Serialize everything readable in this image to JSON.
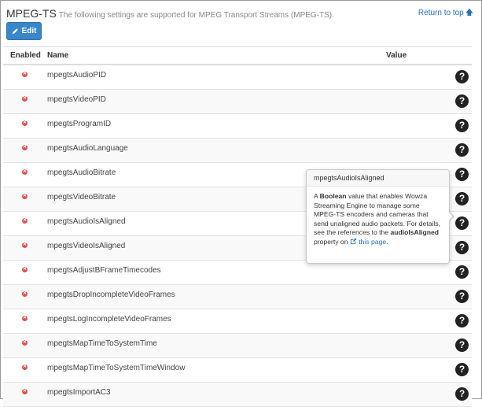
{
  "header": {
    "title": "MPEG-TS",
    "subtitle": "The following settings are supported for MPEG Transport Streams (MPEG-TS).",
    "return_to_top": "Return to top",
    "return_arrow": "🡅"
  },
  "toolbar": {
    "edit_label": "Edit",
    "edit_icon": "pencil-icon"
  },
  "table": {
    "columns": {
      "enabled": "Enabled",
      "name": "Name",
      "value": "Value"
    },
    "rows": [
      {
        "name": "mpegtsAudioPID",
        "enabled": false
      },
      {
        "name": "mpegtsVideoPID",
        "enabled": false
      },
      {
        "name": "mpegtsProgramID",
        "enabled": false
      },
      {
        "name": "mpegtsAudioLanguage",
        "enabled": false
      },
      {
        "name": "mpegtsAudioBitrate",
        "enabled": false
      },
      {
        "name": "mpegtsVideoBitrate",
        "enabled": false
      },
      {
        "name": "mpegtsAudioIsAligned",
        "enabled": false
      },
      {
        "name": "mpegtsVideoIsAligned",
        "enabled": false
      },
      {
        "name": "mpegtsAdjustBFrameTimecodes",
        "enabled": false
      },
      {
        "name": "mpegtsDropIncompleteVideoFrames",
        "enabled": false
      },
      {
        "name": "mpegtsLogIncompleteVideoFrames",
        "enabled": false
      },
      {
        "name": "mpegtsMapTimeToSystemTime",
        "enabled": false
      },
      {
        "name": "mpegtsMapTimeToSystemTimeWindow",
        "enabled": false
      },
      {
        "name": "mpegtsImportAC3",
        "enabled": false
      }
    ],
    "disabled_glyph": "✕",
    "help_glyph": "?"
  },
  "popover": {
    "title": "mpegtsAudioIsAligned",
    "body_pre": "A ",
    "body_bold1": "Boolean",
    "body_mid": " value that enables Wowza Streaming Engine to manage some MPEG-TS encoders and cameras that send unaligned audio packets. For details, see the references to the ",
    "body_bold2": "audioIsAligned",
    "body_post": " property on ",
    "link_text": "this page",
    "end": "."
  },
  "colors": {
    "accent": "#3a87c8",
    "link": "#2a6fb5",
    "disabled": "#d9534f"
  }
}
